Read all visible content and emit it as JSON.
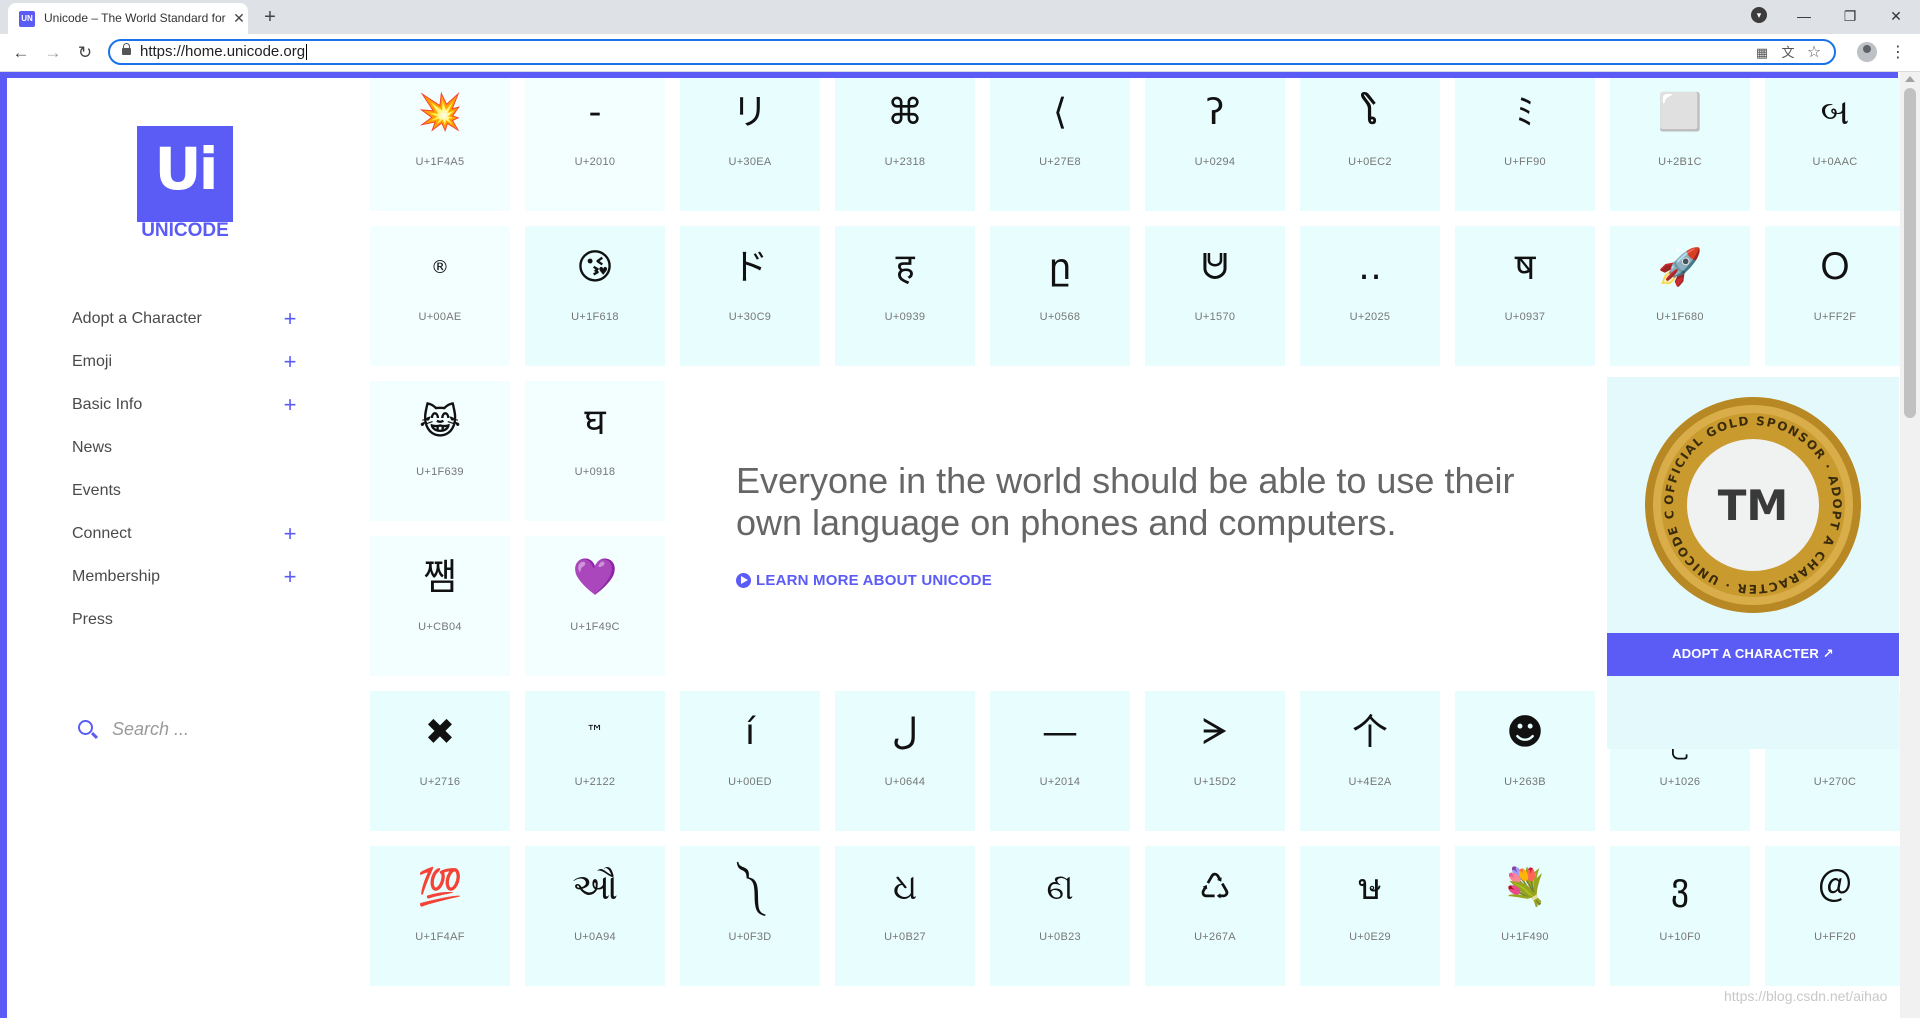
{
  "browser": {
    "tab_title": "Unicode – The World Standard for Text and Emoji",
    "tab_favicon_text": "UN",
    "url": "https://home.unicode.org"
  },
  "site": {
    "logo_mark": "Ui",
    "logo_wordmark": "UNICODE",
    "brand_color": "#5b5bf5",
    "tile_color": "#e8fdfd"
  },
  "sidebar": {
    "items": [
      {
        "label": "Adopt a Character",
        "expandable": true
      },
      {
        "label": "Emoji",
        "expandable": true
      },
      {
        "label": "Basic Info",
        "expandable": true
      },
      {
        "label": "News",
        "expandable": false
      },
      {
        "label": "Events",
        "expandable": false
      },
      {
        "label": "Connect",
        "expandable": true
      },
      {
        "label": "Membership",
        "expandable": true
      },
      {
        "label": "Press",
        "expandable": false
      }
    ],
    "search_placeholder": "Search ..."
  },
  "grid": {
    "row1": [
      {
        "glyph": "💥",
        "code": "U+1F4A5"
      },
      {
        "glyph": "‐",
        "code": "U+2010"
      },
      {
        "glyph": "リ",
        "code": "U+30EA"
      },
      {
        "glyph": "⌘",
        "code": "U+2318"
      },
      {
        "glyph": "⟨",
        "code": "U+27E8"
      },
      {
        "glyph": "ʔ",
        "code": "U+0294"
      },
      {
        "glyph": "ໂ",
        "code": "U+0EC2"
      },
      {
        "glyph": "ﾐ",
        "code": "U+FF90"
      },
      {
        "glyph": "⬜",
        "code": "U+2B1C"
      },
      {
        "glyph": "બ",
        "code": "U+0AAC"
      }
    ],
    "row2": [
      {
        "glyph": "®",
        "code": "U+00AE"
      },
      {
        "glyph": "😘",
        "code": "U+1F618"
      },
      {
        "glyph": "ド",
        "code": "U+30C9"
      },
      {
        "glyph": "ह",
        "code": "U+0939"
      },
      {
        "glyph": "ը",
        "code": "U+0568"
      },
      {
        "glyph": "ᕰ",
        "code": "U+1570"
      },
      {
        "glyph": "‥",
        "code": "U+2025"
      },
      {
        "glyph": "ष",
        "code": "U+0937"
      },
      {
        "glyph": "🚀",
        "code": "U+1F680"
      },
      {
        "glyph": "Ｏ",
        "code": "U+FF2F"
      }
    ],
    "row3": [
      {
        "glyph": "😹",
        "code": "U+1F639"
      },
      {
        "glyph": "घ",
        "code": "U+0918"
      }
    ],
    "row4": [
      {
        "glyph": "쨈",
        "code": "U+CB04"
      },
      {
        "glyph": "💜",
        "code": "U+1F49C"
      }
    ],
    "row5": [
      {
        "glyph": "✖",
        "code": "U+2716"
      },
      {
        "glyph": "™",
        "code": "U+2122"
      },
      {
        "glyph": "í",
        "code": "U+00ED"
      },
      {
        "glyph": "ل",
        "code": "U+0644"
      },
      {
        "glyph": "—",
        "code": "U+2014"
      },
      {
        "glyph": "ᗒ",
        "code": "U+15D2"
      },
      {
        "glyph": "个",
        "code": "U+4E2A"
      },
      {
        "glyph": "☻",
        "code": "U+263B"
      },
      {
        "glyph": "ဦ",
        "code": "U+1026"
      },
      {
        "glyph": "✌",
        "code": "U+270C"
      }
    ],
    "row6": [
      {
        "glyph": "💯",
        "code": "U+1F4AF"
      },
      {
        "glyph": "ઔ",
        "code": "U+0A94"
      },
      {
        "glyph": "༽",
        "code": "U+0F3D"
      },
      {
        "glyph": "ଧ",
        "code": "U+0B27"
      },
      {
        "glyph": "ଣ",
        "code": "U+0B23"
      },
      {
        "glyph": "♺",
        "code": "U+267A"
      },
      {
        "glyph": "ษ",
        "code": "U+0E29"
      },
      {
        "glyph": "💐",
        "code": "U+1F490"
      },
      {
        "glyph": "ვ",
        "code": "U+10F0"
      },
      {
        "glyph": "＠",
        "code": "U+FF20"
      }
    ]
  },
  "hero": {
    "line1": "Everyone in the world should be able to use their",
    "line2": "own language on phones and computers.",
    "cta": "LEARN MORE ABOUT UNICODE"
  },
  "sponsor": {
    "ring_text": "OFFICIAL GOLD SPONSOR · ADOPT A CHARACTER · UNICODE CONSORTIUM ·",
    "mark": "TM",
    "gold_color": "#c99a2e",
    "cta": "ADOPT A CHARACTER ↗"
  },
  "watermark": "https://blog.csdn.net/aihao"
}
